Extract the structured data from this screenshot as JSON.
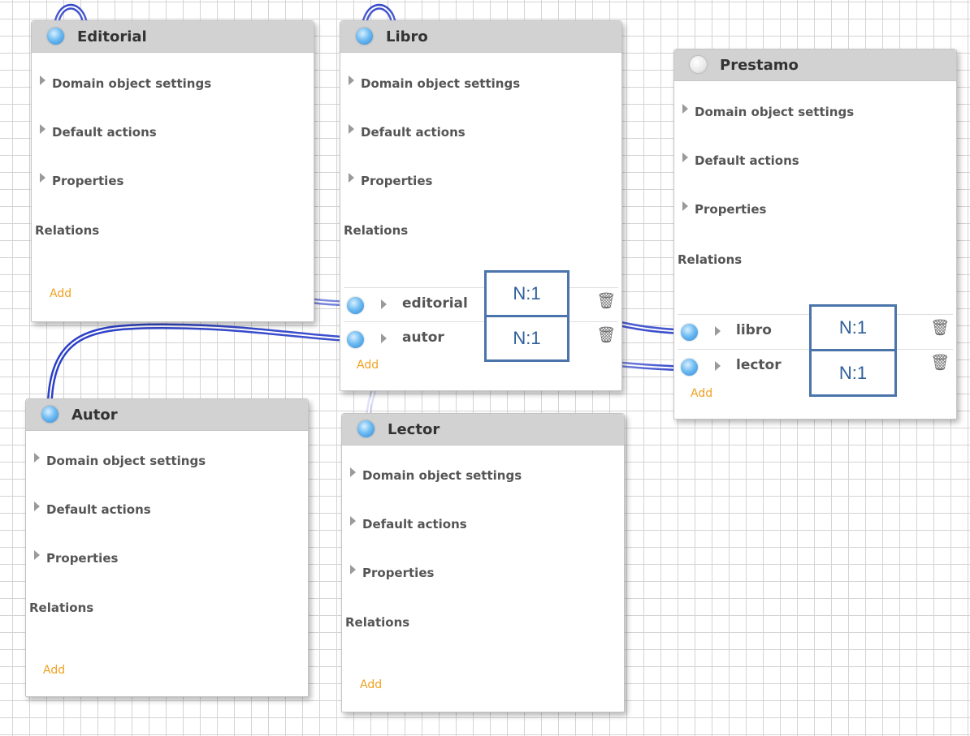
{
  "common": {
    "sections": [
      "Domain object settings",
      "Default actions",
      "Properties"
    ],
    "relations_label": "Relations",
    "add_label": "Add"
  },
  "cards": {
    "editorial": {
      "title": "Editorial"
    },
    "libro": {
      "title": "Libro",
      "relations": [
        {
          "name": "editorial",
          "cardinality": "N:1"
        },
        {
          "name": "autor",
          "cardinality": "N:1"
        }
      ]
    },
    "prestamo": {
      "title": "Prestamo",
      "relations": [
        {
          "name": "libro",
          "cardinality": "N:1"
        },
        {
          "name": "lector",
          "cardinality": "N:1"
        }
      ]
    },
    "autor": {
      "title": "Autor"
    },
    "lector": {
      "title": "Lector"
    }
  },
  "colors": {
    "wire": "#2b3fc8",
    "cardinality_border": "#4a74aa",
    "add_link": "#f0a020"
  },
  "icons": {
    "delete": "trash-icon",
    "connector": "endpoint-icon"
  }
}
